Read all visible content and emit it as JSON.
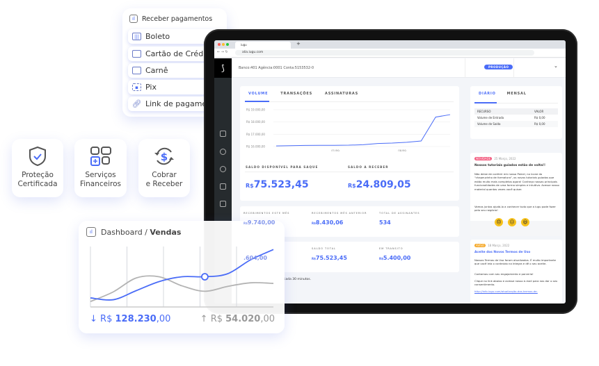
{
  "payments": {
    "title": "Receber pagamentos",
    "items": [
      {
        "label": "Boleto",
        "icon": "barcode-icon"
      },
      {
        "label": "Cartão de Crédito",
        "icon": "credit-card-icon"
      },
      {
        "label": "Carnê",
        "icon": "booklet-icon"
      },
      {
        "label": "Pix",
        "icon": "qr-code-icon"
      },
      {
        "label": "Link de pagamento",
        "icon": "link-icon"
      }
    ]
  },
  "features": [
    {
      "label1": "Proteção",
      "label2": "Certificada",
      "icon": "shield-check-icon"
    },
    {
      "label1": "Serviços",
      "label2": "Financeiros",
      "icon": "apps-grid-icon"
    },
    {
      "label1": "Cobrar",
      "label2": "e Receber",
      "icon": "dollar-cycle-icon"
    }
  ],
  "browser": {
    "tab_title": "iugu",
    "url": "alia.iugu.com",
    "new_tab": "+"
  },
  "header": {
    "account": "Banco:401 Agência:0001 Conta:5153532-0",
    "env_badge": "PRODUÇÃO",
    "chevron": "⌄"
  },
  "volume": {
    "tabs": [
      "VOLUME",
      "TRANSAÇÕES",
      "ASSINATURAS"
    ],
    "chart": {
      "type": "line",
      "y_ticks": [
        "R$ 19.000,00",
        "R$ 18.000,00",
        "R$ 17.000,00",
        "R$ 16.000,00"
      ],
      "x_ticks": [
        "01/09",
        "08/09"
      ],
      "ylim": [
        16000,
        19000
      ],
      "values": [
        16050,
        16070,
        16090,
        16100,
        16100,
        16110,
        16150,
        16250,
        16280,
        16350,
        16450,
        18400,
        18600
      ],
      "color": "#4a6cf7"
    },
    "available_label": "SALDO DISPONÍVEL PARA SAQUE",
    "available_currency": "R$",
    "available_value": "75.523,45",
    "receivable_label": "SALDO A RECEBER",
    "receivable_currency": "R$",
    "receivable_value": "24.809,05"
  },
  "stats": {
    "row1": [
      {
        "label": "RECEBIMENTOS ESTE MÊS",
        "currency": "R$",
        "value": "9.740,00"
      },
      {
        "label": "RECEBIMENTOS MÊS ANTERIOR",
        "currency": "R$",
        "value": "8.430,06"
      },
      {
        "label": "TOTAL DE ASSINANTES",
        "currency": "",
        "value": "534"
      }
    ],
    "row2": [
      {
        "label": "",
        "currency": "",
        "value": ".604,00"
      },
      {
        "label": "SALDO TOTAL",
        "currency": "R$",
        "value": "75.523,45"
      },
      {
        "label": "EM TRANSITO",
        "currency": "R$",
        "value": "5.400,00"
      }
    ],
    "footnote": "cada 30 minutos."
  },
  "daily": {
    "tabs": [
      "DIÁRIO",
      "MENSAL"
    ],
    "columns": [
      "RECURSO",
      "VALOR"
    ],
    "rows": [
      [
        "Volume de Entrada",
        "R$ 0,00"
      ],
      [
        "Volume de Saída",
        "R$ 0,00"
      ]
    ]
  },
  "news": [
    {
      "badge": "NOVIDADE",
      "badge_color": "#f2557a",
      "date": "25 Março, 2022",
      "title": "Nossos tutoriais guiados estão de volta!!",
      "p1": "Não deixe de conferir em nosso Painel, no ícone do \"chapeuzinho de formatura\", os novos tutoriais guiados que estão muito mais completos agora! Conheça nossas principais funcionalidades de uma forma simples e intuitiva. Acesse nosso material quantas vezes você quiser.",
      "p2": "Vamos juntos ajudá-lo a conhecer tudo que a iugu pode fazer pelo seu negócio!",
      "reactions": [
        "😞",
        "😐",
        "😃"
      ]
    },
    {
      "badge": "AVISO",
      "badge_color": "#f5a623",
      "date": "18 Março, 2022",
      "title": "Aceite dos Novos Termos de Uso",
      "p1": "Nossos Termos de Uso foram atualizados. É muito importante que você leia o conteúdo na íntegra e dê o seu aceite.",
      "p2": "Contamos com seu engajamento e parceria!",
      "p3": "Clique no link abaixo e acesse nosso e-mail para nos dar o seu consentimento.",
      "link": "http://info.iugu.com/atualização-dos-termos-de-"
    }
  ],
  "dashboard": {
    "title_prefix": "Dashboard / ",
    "title_bold": "Vendas",
    "series": [
      {
        "values": [
          15,
          12,
          27,
          42,
          50,
          50,
          55,
          78,
          95
        ],
        "color": "#4a6cf7"
      },
      {
        "values": [
          9,
          25,
          48,
          50,
          35,
          26,
          34,
          40,
          39
        ],
        "color": "#b3b3b3"
      }
    ],
    "highlight_index": 5,
    "down": {
      "currency": "R$",
      "int": "128.230",
      "dec": ",00",
      "color": "#4a6cf7"
    },
    "up": {
      "currency": "R$",
      "int": "54.020",
      "dec": ",00",
      "color": "#999999"
    }
  }
}
